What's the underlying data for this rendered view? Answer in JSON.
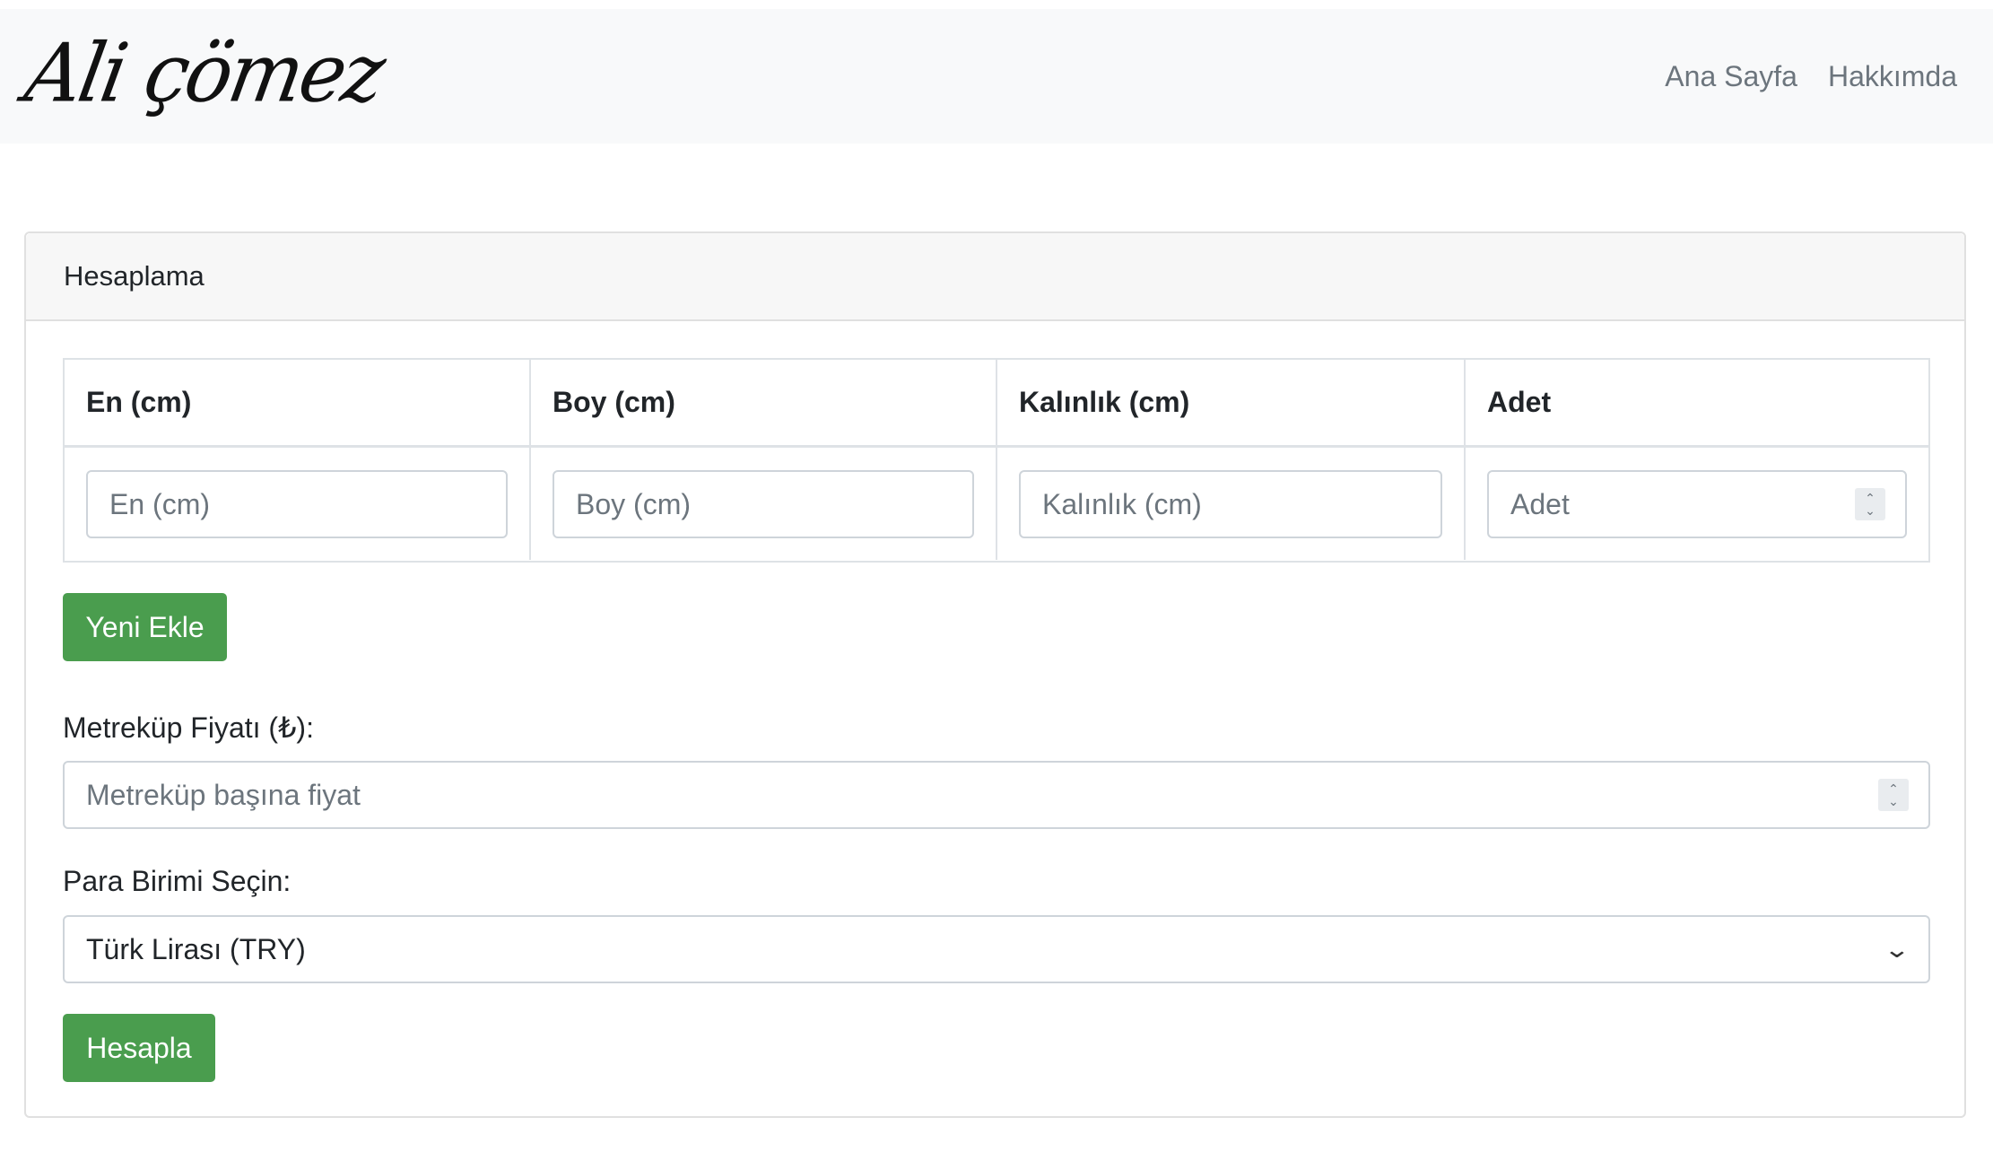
{
  "navbar": {
    "brand": "Ali çömez",
    "links": [
      "Ana Sayfa",
      "Hakkımda"
    ]
  },
  "card": {
    "title": "Hesaplama",
    "table": {
      "headers": [
        "En (cm)",
        "Boy (cm)",
        "Kalınlık (cm)",
        "Adet"
      ],
      "placeholders": [
        "En (cm)",
        "Boy (cm)",
        "Kalınlık (cm)",
        "Adet"
      ]
    },
    "add_button": "Yeni Ekle",
    "price_label": "Metreküp Fiyatı (₺):",
    "price_placeholder": "Metreküp başına fiyat",
    "currency_label": "Para Birimi Seçin:",
    "currency_selected": "Türk Lirası (TRY)",
    "calc_button": "Hesapla"
  },
  "colors": {
    "button_green": "#4a9d4e",
    "navbar_bg": "#f8f9fa",
    "card_header_bg": "#f7f7f7"
  }
}
